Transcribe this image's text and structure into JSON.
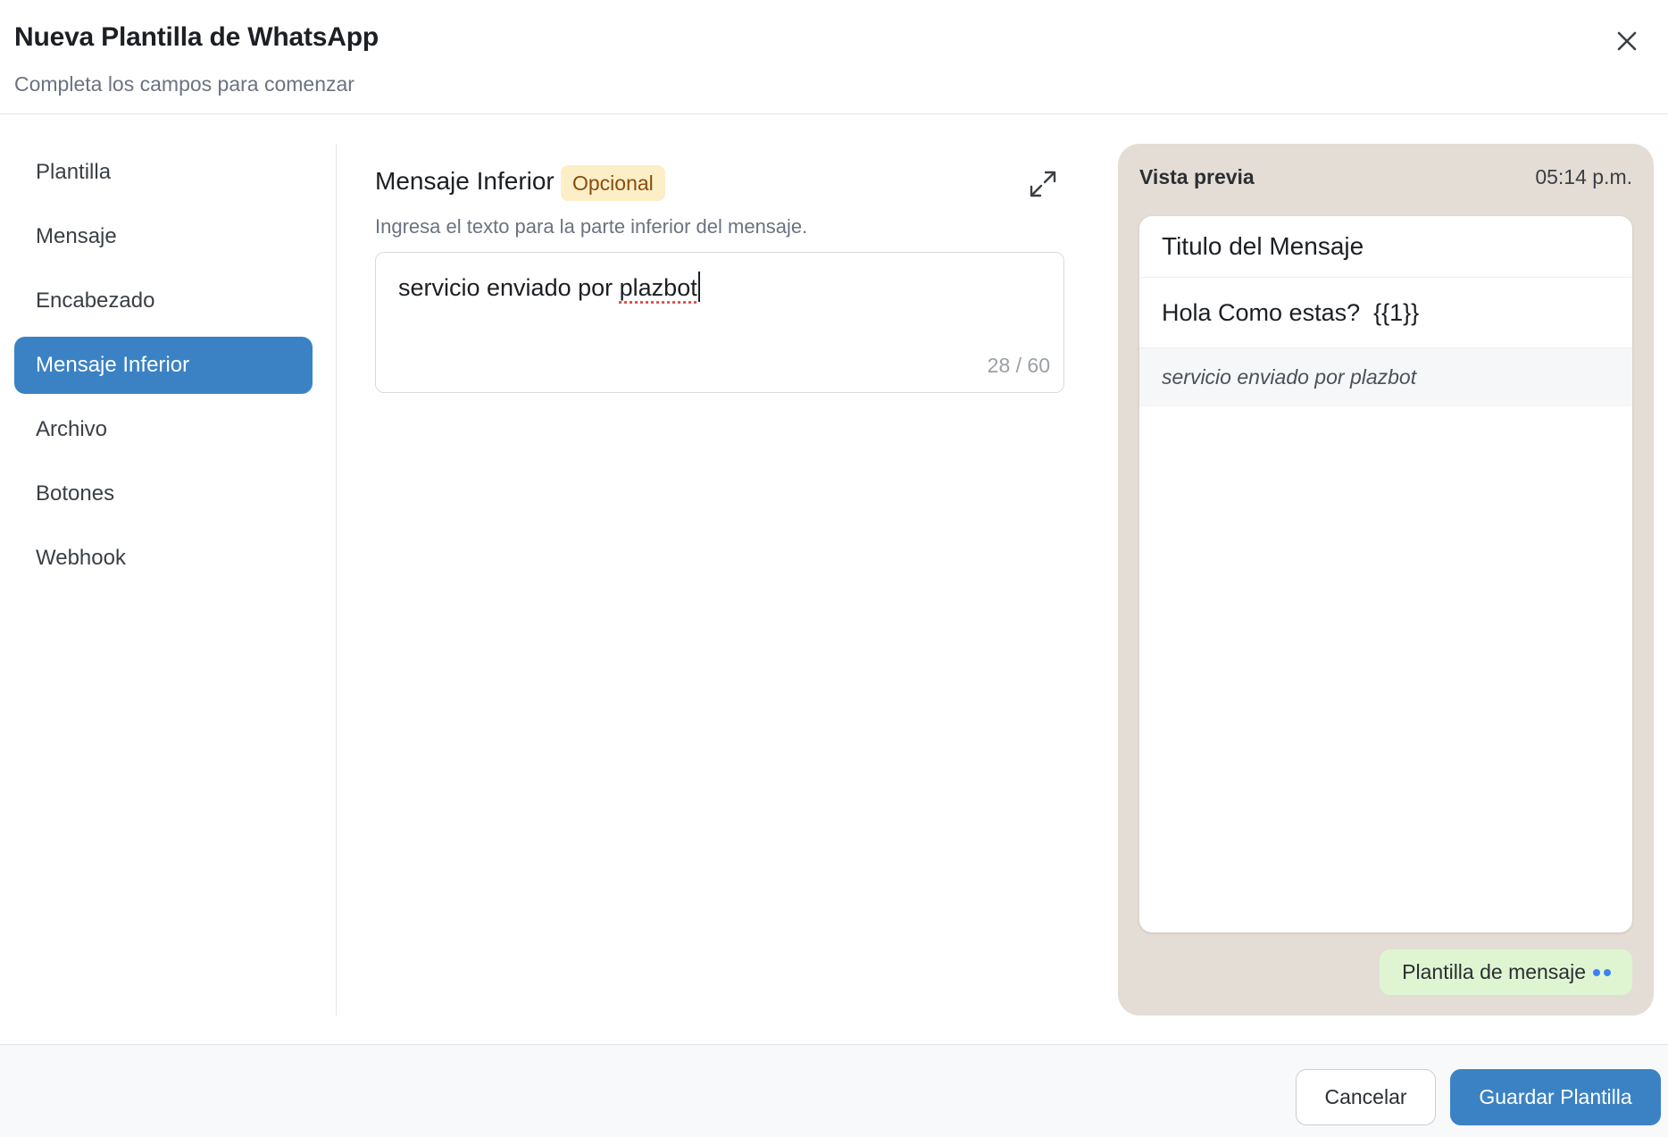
{
  "dialog": {
    "title": "Nueva Plantilla de WhatsApp",
    "subtitle": "Completa los campos para comenzar",
    "close_icon": "close-icon"
  },
  "sidebar": {
    "items": [
      {
        "label": "Plantilla",
        "active": false
      },
      {
        "label": "Mensaje",
        "active": false
      },
      {
        "label": "Encabezado",
        "active": false
      },
      {
        "label": "Mensaje Inferior",
        "active": true
      },
      {
        "label": "Archivo",
        "active": false
      },
      {
        "label": "Botones",
        "active": false
      },
      {
        "label": "Webhook",
        "active": false
      }
    ]
  },
  "section": {
    "title": "Mensaje Inferior",
    "badge": "Opcional",
    "description": "Ingresa el texto para la parte inferior del mensaje.",
    "expand_icon": "expand-icon",
    "textarea": {
      "value_prefix": "servicio enviado por ",
      "value_misspelled": "plazbot",
      "counter": "28 / 60"
    }
  },
  "preview": {
    "label": "Vista previa",
    "time": "05:14 p.m.",
    "card": {
      "title": "Titulo del Mensaje",
      "body": "Hola Como estas?  {{1}}",
      "footer": "servicio enviado por plazbot"
    },
    "chip": "Plantilla de mensaje"
  },
  "footer": {
    "cancel_label": "Cancelar",
    "save_label": "Guardar Plantilla"
  },
  "colors": {
    "accent": "#3b82c4",
    "badge_bg": "#fcefc7",
    "badge_text": "#8a4b0c",
    "preview_bg": "#e4ddd5",
    "chip_bg": "#dff5d2"
  }
}
